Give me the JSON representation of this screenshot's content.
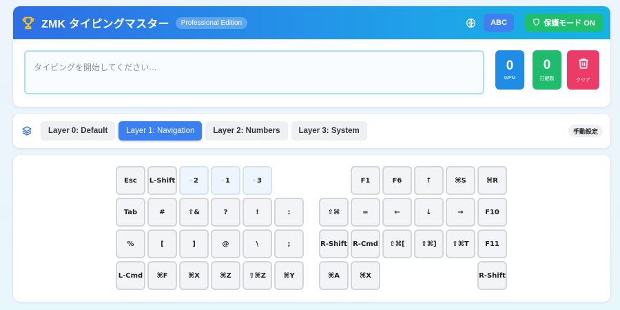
{
  "header": {
    "title": "ZMK タイピングマスター",
    "edition": "Professional Edition",
    "lang_button": "ABC",
    "protect_button": "保護モード ON",
    "colors": {
      "gradient_start": "#2e6ee6",
      "gradient_end": "#16b4e2",
      "trophy": "#f5c518"
    }
  },
  "typing": {
    "placeholder": "タイピングを開始してください...",
    "value": ""
  },
  "stats": {
    "wpm_value": "0",
    "wpm_label": "WPM",
    "keys_value": "0",
    "keys_label": "打鍵数",
    "clear_label": "クリア"
  },
  "layers": {
    "tabs": [
      {
        "label": "Layer 0: Default"
      },
      {
        "label": "Layer 1: Navigation"
      },
      {
        "label": "Layer 2: Numbers"
      },
      {
        "label": "Layer 3: System"
      }
    ],
    "active_index": 1,
    "manual_button": "手動設定"
  },
  "keyboard": {
    "left_rows": [
      [
        "Esc",
        "L-Shift",
        "2",
        "1",
        "3",
        ""
      ],
      [
        "Tab",
        "#",
        "⇧&",
        "?",
        "!",
        ":"
      ],
      [
        "%",
        "[",
        "]",
        "@",
        "\\",
        ";"
      ],
      [
        "L-Cmd",
        "⌘F",
        "⌘X",
        "⌘Z",
        "⇧⌘Z",
        "⌘Y"
      ]
    ],
    "right_rows": [
      [
        "",
        "F1",
        "F6",
        "↑",
        "⌘S",
        "⌘R"
      ],
      [
        "⇧⌘",
        "=",
        "←",
        "↓",
        "→",
        "F10"
      ],
      [
        "R-Shift",
        "R-Cmd",
        "⇧⌘[",
        "⇧⌘]",
        "⇧⌘T",
        "F11"
      ],
      [
        "⌘A",
        "⌘X",
        "",
        "",
        "",
        "R-Shift"
      ]
    ],
    "dim_keys": [
      "2",
      "1",
      "3"
    ]
  }
}
